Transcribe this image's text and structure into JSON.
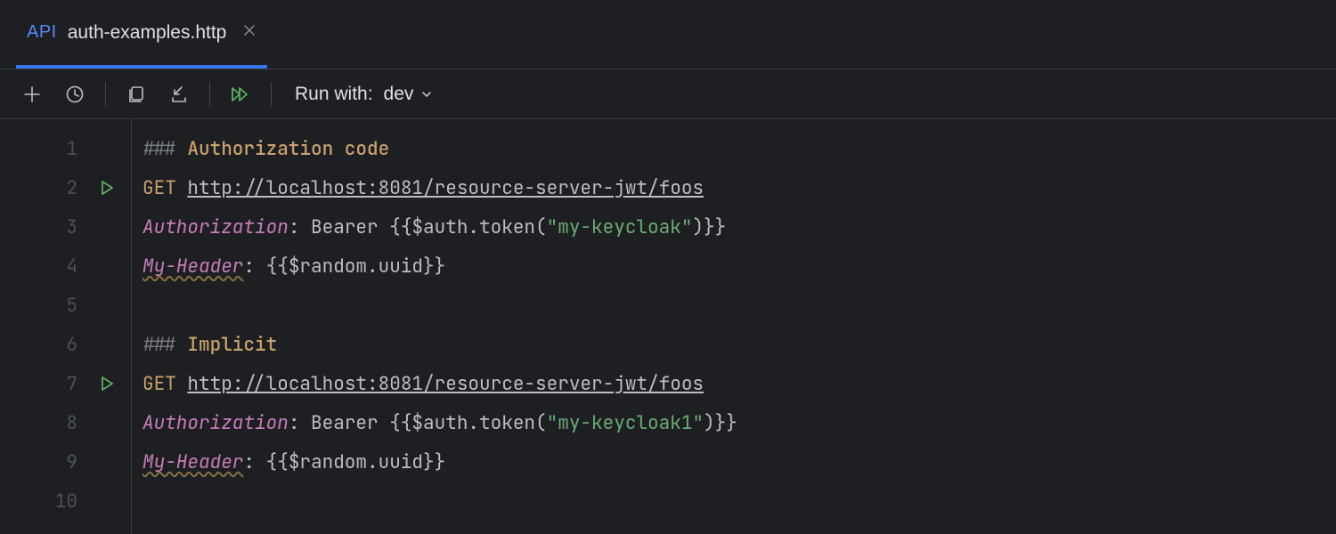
{
  "tab": {
    "badge": "API",
    "name": "auth-examples.http"
  },
  "toolbar": {
    "run_with_label": "Run with:",
    "env": "dev"
  },
  "gutter": {
    "line_count": 10,
    "run_markers": [
      2,
      7
    ]
  },
  "code": {
    "lines": [
      {
        "n": 1,
        "type": "section",
        "marker": "### ",
        "title": "Authorization code"
      },
      {
        "n": 2,
        "type": "request",
        "method": "GET",
        "sp": " ",
        "url": "http://localhost:8081/resource-server-jwt/foos"
      },
      {
        "n": 3,
        "type": "header-auth",
        "name": "Authorization",
        "sep": ": ",
        "prefix": "Bearer ",
        "open": "{{",
        "fn": "$auth.token(",
        "arg": "\"my-keycloak\"",
        "close_fn": ")",
        "close": "}}"
      },
      {
        "n": 4,
        "type": "header-plain",
        "name": "My-Header",
        "warn": true,
        "sep": ": ",
        "open": "{{",
        "expr": "$random.uuid",
        "close": "}}"
      },
      {
        "n": 5,
        "type": "blank"
      },
      {
        "n": 6,
        "type": "section",
        "marker": "### ",
        "title": "Implicit"
      },
      {
        "n": 7,
        "type": "request",
        "method": "GET",
        "sp": " ",
        "url": "http://localhost:8081/resource-server-jwt/foos"
      },
      {
        "n": 8,
        "type": "header-auth",
        "name": "Authorization",
        "sep": ": ",
        "prefix": "Bearer ",
        "open": "{{",
        "fn": "$auth.token(",
        "arg": "\"my-keycloak1\"",
        "close_fn": ")",
        "close": "}}"
      },
      {
        "n": 9,
        "type": "header-plain",
        "name": "My-Header",
        "warn": true,
        "sep": ": ",
        "open": "{{",
        "expr": "$random.uuid",
        "close": "}}"
      },
      {
        "n": 10,
        "type": "blank"
      }
    ]
  }
}
